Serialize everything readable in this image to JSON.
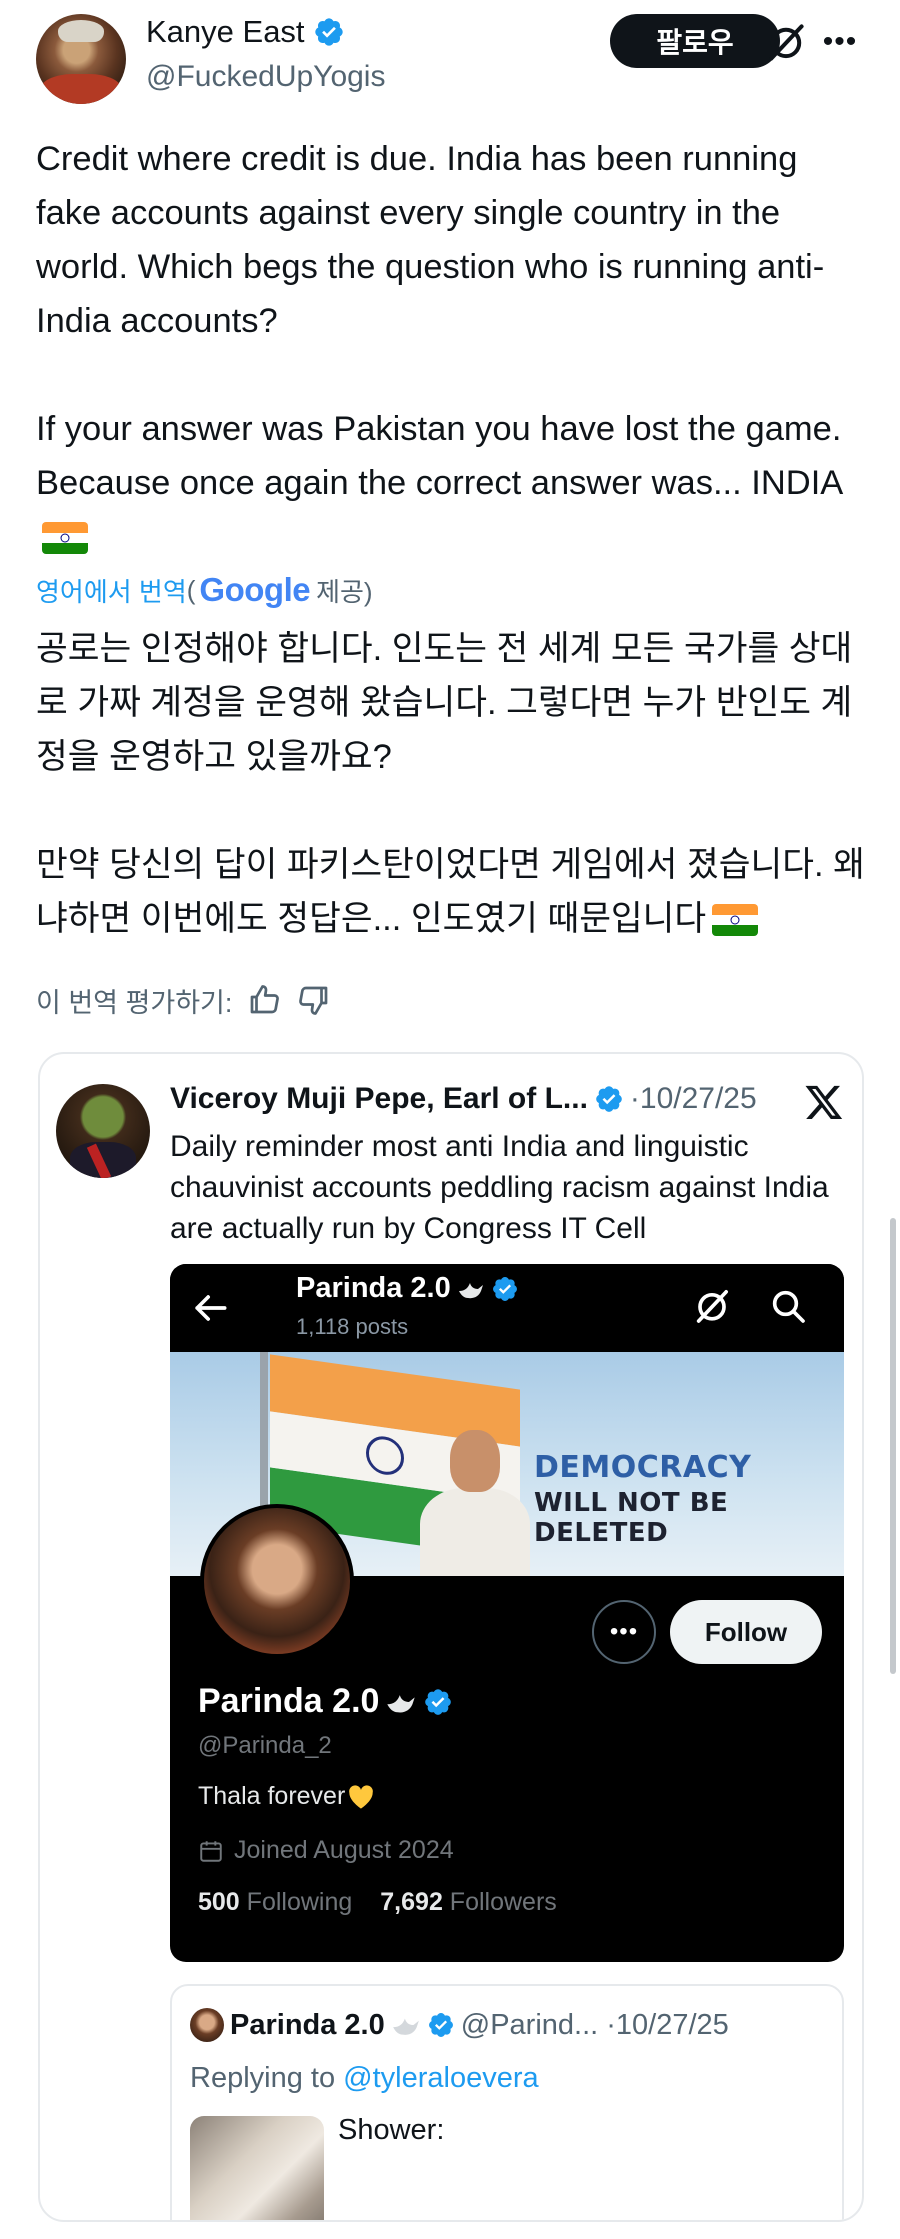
{
  "author": {
    "display_name": "Kanye East",
    "handle": "@FuckedUpYogis",
    "follow_label": "팔로우"
  },
  "tweet": {
    "text": "Credit where credit is due. India has been running fake accounts against every single country in the world. Which begs the question who is running anti-India accounts?\n\nIf your answer was Pakistan you have lost the game. Because once again the correct answer was... INDIA",
    "translate_link": "영어에서 번역",
    "translate_paren_open": "(",
    "google_label": "Google",
    "translate_provided": "제공)",
    "translated_text": "공로는 인정해야 합니다. 인도는 전 세계 모든 국가를 상대로 가짜 계정을 운영해 왔습니다. 그렇다면 누가 반인도 계정을 운영하고 있을까요?\n\n만약 당신의 답이 파키스탄이었다면 게임에서 졌습니다. 왜냐하면 이번에도 정답은... 인도였기 때문입니다",
    "rate_label": "이 번역 평가하기:"
  },
  "quote": {
    "name": "Viceroy Muji Pepe, Earl of L...",
    "date": "·10/27/25",
    "text": "Daily reminder most anti India and linguistic chauvinist accounts peddling racism against India are actually run by Congress IT Cell"
  },
  "profile_shot": {
    "top_title": "Parinda 2.0",
    "posts": "1,118 posts",
    "banner_line1": "DEMOCRACY",
    "banner_line2": "WILL NOT BE DELETED",
    "more_label": "•••",
    "follow_label": "Follow",
    "name": "Parinda 2.0",
    "handle": "@Parinda_2",
    "bio": "Thala forever",
    "joined": "Joined August 2024",
    "following_count": "500",
    "following_label": "Following",
    "followers_count": "7,692",
    "followers_label": "Followers"
  },
  "reply": {
    "name": "Parinda 2.0",
    "meta": "@Parind... ·10/27/25",
    "replying_prefix": "Replying to ",
    "replying_handle": "@tyleraloevera",
    "text": "Shower:"
  },
  "colors": {
    "accent": "#1d9bf0",
    "text": "#0f1419",
    "secondary": "#536471",
    "flag_saffron": "#ff9933",
    "flag_green": "#138808"
  },
  "icons": [
    "verified-badge-icon",
    "grok-icon",
    "more-icon",
    "thumbs-up-icon",
    "thumbs-down-icon",
    "x-logo-icon",
    "back-arrow-icon",
    "search-icon",
    "dove-icon",
    "heart-icon",
    "calendar-icon",
    "india-flag-icon"
  ]
}
